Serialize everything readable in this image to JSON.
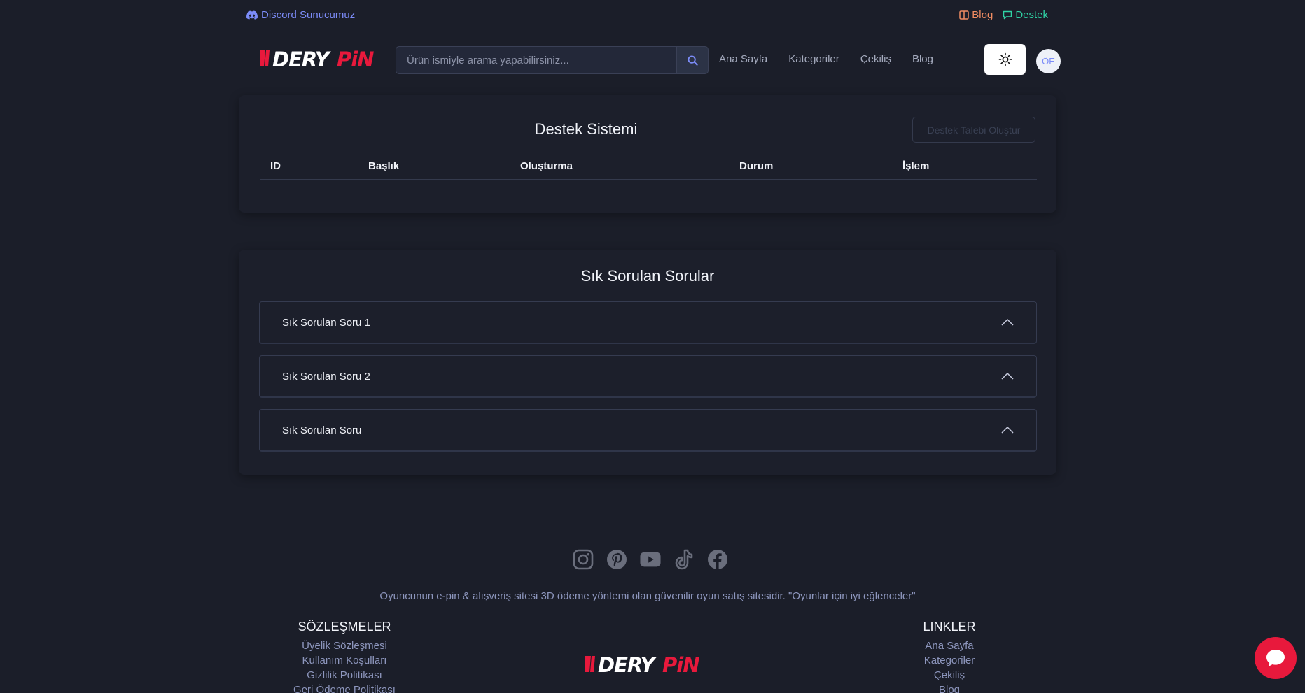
{
  "topbar": {
    "discord_label": "Discord Sunucumuz",
    "blog_label": "Blog",
    "support_label": "Destek",
    "colors": {
      "discord": "#7c8cf8",
      "blog": "#f08c62",
      "support": "#2fd3a5"
    }
  },
  "header": {
    "logo_text": "DERYPiN",
    "search": {
      "placeholder": "Ürün ismiyle arama yapabilirsiniz...",
      "value": ""
    },
    "nav": [
      "Ana Sayfa",
      "Kategoriler",
      "Çekiliş",
      "Blog"
    ],
    "avatar_initials": "ÖE"
  },
  "support": {
    "title": "Destek Sistemi",
    "create_button": "Destek Talebi Oluştur",
    "columns": [
      "ID",
      "Başlık",
      "Oluşturma",
      "Durum",
      "İşlem"
    ],
    "rows": []
  },
  "faq": {
    "title": "Sık Sorulan Sorular",
    "items": [
      {
        "question": "Sık Sorulan Soru 1"
      },
      {
        "question": "Sık Sorulan Soru 2"
      },
      {
        "question": "Sık Sorulan Soru"
      }
    ]
  },
  "footer": {
    "social_icons": [
      "instagram-icon",
      "pinterest-icon",
      "youtube-icon",
      "tiktok-icon",
      "facebook-icon"
    ],
    "tagline": "Oyuncunun e-pin & alışveriş sitesi 3D ödeme yöntemi olan güvenilir oyun satış sitesidir. \"Oyunlar için iyi eğlenceler\"",
    "contracts": {
      "heading": "SÖZLEŞMELER",
      "links": [
        "Üyelik Sözleşmesi",
        "Kullanım Koşulları",
        "Gizlilik Politikası",
        "Geri Ödeme Politikası"
      ]
    },
    "links": {
      "heading": "LINKLER",
      "links": [
        "Ana Sayfa",
        "Kategoriler",
        "Çekiliş",
        "Blog"
      ]
    }
  },
  "brand": {
    "accent": "#e8193c",
    "background": "#1b1e29"
  }
}
